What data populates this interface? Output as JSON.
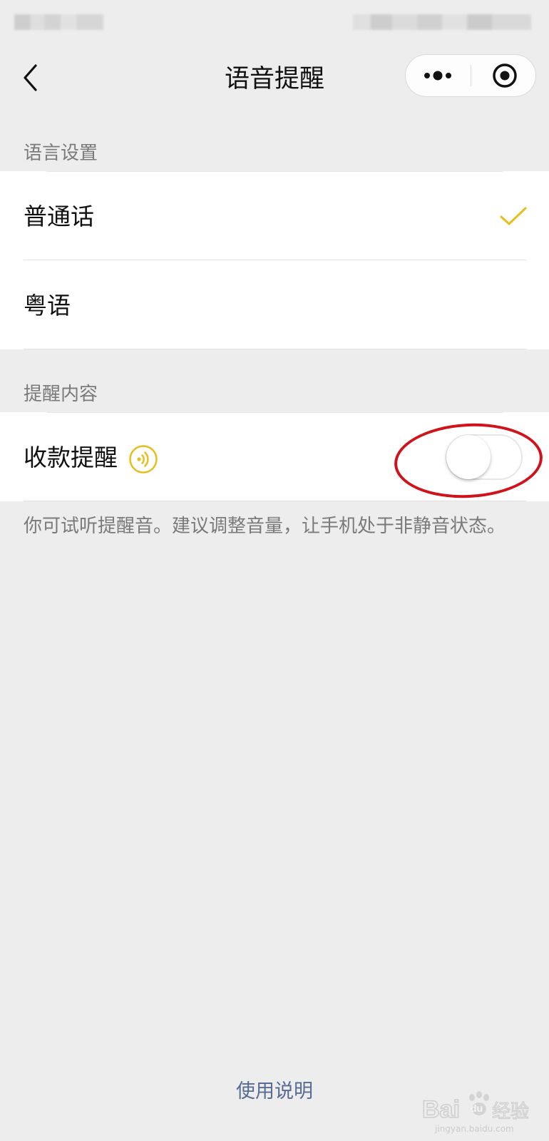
{
  "nav": {
    "title": "语音提醒"
  },
  "sections": {
    "language": {
      "label": "语言设置",
      "options": [
        {
          "label": "普通话",
          "selected": true
        },
        {
          "label": "粤语",
          "selected": false
        }
      ]
    },
    "reminder": {
      "label": "提醒内容",
      "item": {
        "label": "收款提醒",
        "enabled": false
      },
      "hint": "你可试听提醒音。建议调整音量，让手机处于非静音状态。"
    }
  },
  "footer": {
    "help_link": "使用说明"
  },
  "watermark": {
    "text": "Baidu 经验",
    "sub": "jingyan.baidu.com"
  },
  "colors": {
    "accent": "#e6be1e",
    "link": "#576b95",
    "annotation": "#d0121a"
  },
  "icons": {
    "back": "chevron-left-icon",
    "more": "more-dots-icon",
    "close": "target-circle-icon",
    "selected": "checkmark-icon",
    "preview": "speaker-wave-icon"
  }
}
